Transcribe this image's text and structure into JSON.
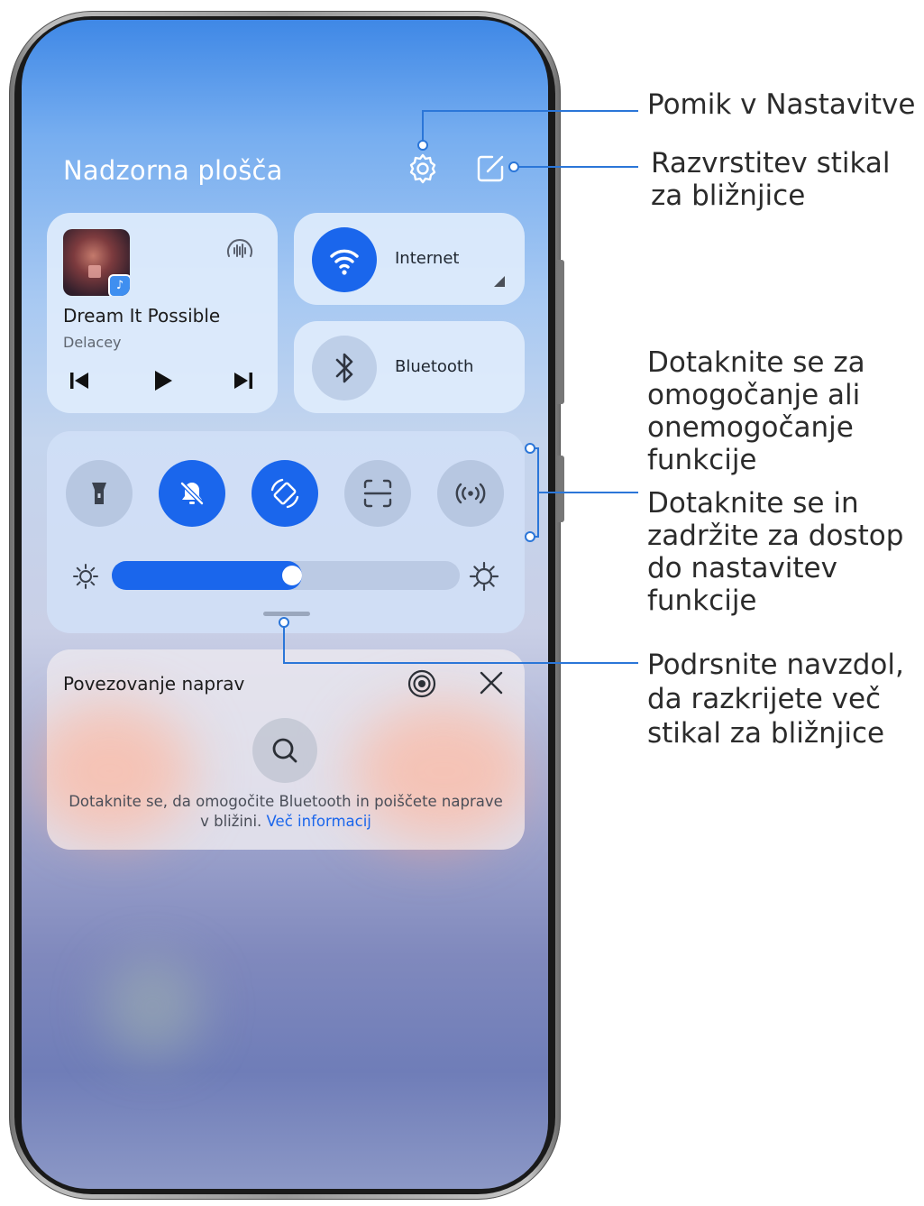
{
  "header": {
    "title": "Nadzorna plošča",
    "settings_icon": "gear-icon",
    "edit_icon": "edit-square-icon"
  },
  "media": {
    "title": "Dream It Possible",
    "artist": "Delacey",
    "controls": [
      "previous-icon",
      "play-icon",
      "next-icon"
    ]
  },
  "tiles": [
    {
      "label": "Internet",
      "icon": "wifi-icon",
      "active": true
    },
    {
      "label": "Bluetooth",
      "icon": "bluetooth-icon",
      "active": false
    }
  ],
  "toggles": [
    {
      "icon": "flashlight-icon",
      "active": false
    },
    {
      "icon": "bell-off-icon",
      "active": true
    },
    {
      "icon": "auto-rotate-icon",
      "active": true
    },
    {
      "icon": "scan-icon",
      "active": false
    },
    {
      "icon": "hotspot-icon",
      "active": false
    }
  ],
  "brightness": {
    "value": 0.5
  },
  "device_connection": {
    "title": "Povezovanje naprav",
    "description": "Dotaknite se, da omogočite Bluetooth in poiščete naprave v bližini.",
    "link": "Več informacij"
  },
  "annotations": {
    "settings": "Pomik v Nastavitve",
    "sort_shortcuts": "Razvrstitev stikal za bližnjice",
    "tap_toggle": "Dotaknite se za omogočanje ali onemogočanje funkcije",
    "hold_settings": "Dotaknite se in zadržite za dostop do nastavitev funkcije",
    "swipe_down": "Podrsnite navzdol, da razkrijete več stikal za bližnjice"
  },
  "colors": {
    "accent": "#1a66ec",
    "callout": "#2b76d8"
  }
}
